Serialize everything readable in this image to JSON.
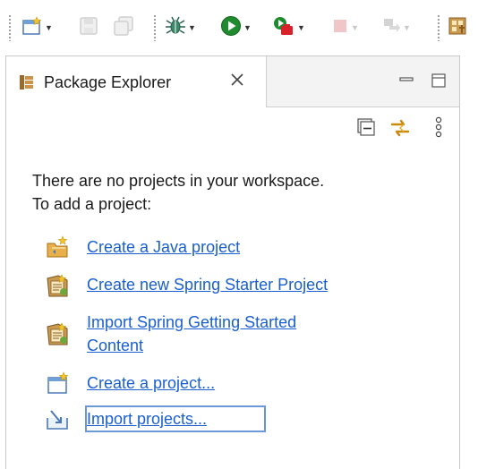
{
  "toolbar": {
    "items": [
      {
        "icon": "new-wizard-icon",
        "dropdown": true,
        "enabled": true
      },
      {
        "icon": "save-icon",
        "dropdown": false,
        "enabled": false
      },
      {
        "icon": "save-all-icon",
        "dropdown": false,
        "enabled": false
      },
      {
        "icon": "debug-icon",
        "dropdown": true,
        "enabled": true
      },
      {
        "icon": "run-icon",
        "dropdown": true,
        "enabled": true
      },
      {
        "icon": "external-tools-icon",
        "dropdown": true,
        "enabled": true
      },
      {
        "icon": "stop-icon",
        "dropdown": true,
        "enabled": false
      },
      {
        "icon": "next-annotation-icon",
        "dropdown": true,
        "enabled": false
      },
      {
        "icon": "open-perspective-icon",
        "dropdown": false,
        "enabled": true
      }
    ]
  },
  "view": {
    "tab_title": "Package Explorer",
    "tab_icon": "package-explorer-icon",
    "close_icon": "close-icon",
    "minimize_icon": "minimize-icon",
    "maximize_icon": "maximize-icon",
    "toolbar_icons": [
      "collapse-all-icon",
      "link-with-editor-icon",
      "view-menu-icon"
    ]
  },
  "content": {
    "message_line1": "There are no projects in your workspace.",
    "message_line2": "To add a project:",
    "links": [
      {
        "label": "Create a Java project",
        "icon": "new-java-project-icon"
      },
      {
        "label": "Create new Spring Starter Project",
        "icon": "spring-starter-icon"
      },
      {
        "label_line1": "Import Spring Getting Started ",
        "label_line2": "Content",
        "icon": "spring-import-icon"
      },
      {
        "label": "Create a project...",
        "icon": "new-project-icon"
      },
      {
        "label": "Import projects...",
        "icon": "import-projects-icon",
        "focused": true
      }
    ]
  },
  "colors": {
    "link": "#1a5fd0",
    "focus_outline": "#6a98d8",
    "tab_strip_bg": "#f3f3f3",
    "run_green": "#1f8a2e",
    "external_tools_red": "#d8222a"
  }
}
